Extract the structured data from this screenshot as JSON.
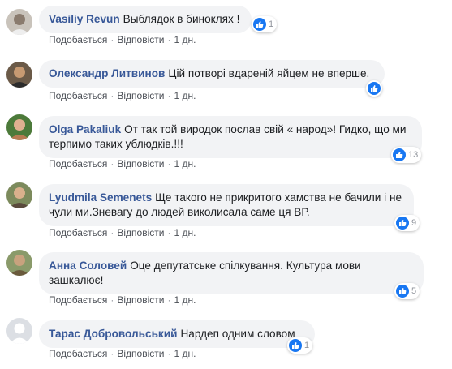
{
  "comments": [
    {
      "author": "Vasiliy Revun",
      "text": "Выблядок в биноклях !",
      "reactions": "1",
      "like": "Подобається",
      "reply": "Відповісти",
      "time": "1 дн."
    },
    {
      "author": "Олександр Литвинов",
      "text": "Цій потворі вдареній яйцем не вперше.",
      "reactions": "",
      "like": "Подобається",
      "reply": "Відповісти",
      "time": "1 дн."
    },
    {
      "author": "Olga Pakaliuk",
      "text": "От так той виродок послав свій « народ»! Гидко, що ми терпимо таких ублюдків.!!!",
      "reactions": "13",
      "like": "Подобається",
      "reply": "Відповісти",
      "time": "1 дн."
    },
    {
      "author": "Lyudmila Semenets",
      "text": "Ще такого не прикритого хамства не бачили і не чули ми.Зневагу до людей виколисала саме ця ВР.",
      "reactions": "9",
      "like": "Подобається",
      "reply": "Відповісти",
      "time": "1 дн."
    },
    {
      "author": "Анна Соловей",
      "text": "Оце депутатське спілкування. Культура мови зашкалює!",
      "reactions": "5",
      "like": "Подобається",
      "reply": "Відповісти",
      "time": "1 дн."
    },
    {
      "author": "Тарас Добровольський",
      "text": "Нардеп одним словом",
      "reactions": "1",
      "like": "Подобається",
      "reply": "Відповісти",
      "time": "1 дн."
    }
  ],
  "icons": {
    "reaction": "like-thumb-icon",
    "avatar": "profile-photo"
  },
  "colors": {
    "author": "#385898",
    "bubble": "#f2f3f5",
    "like_badge": "#1877f2",
    "meta": "#90949c"
  }
}
